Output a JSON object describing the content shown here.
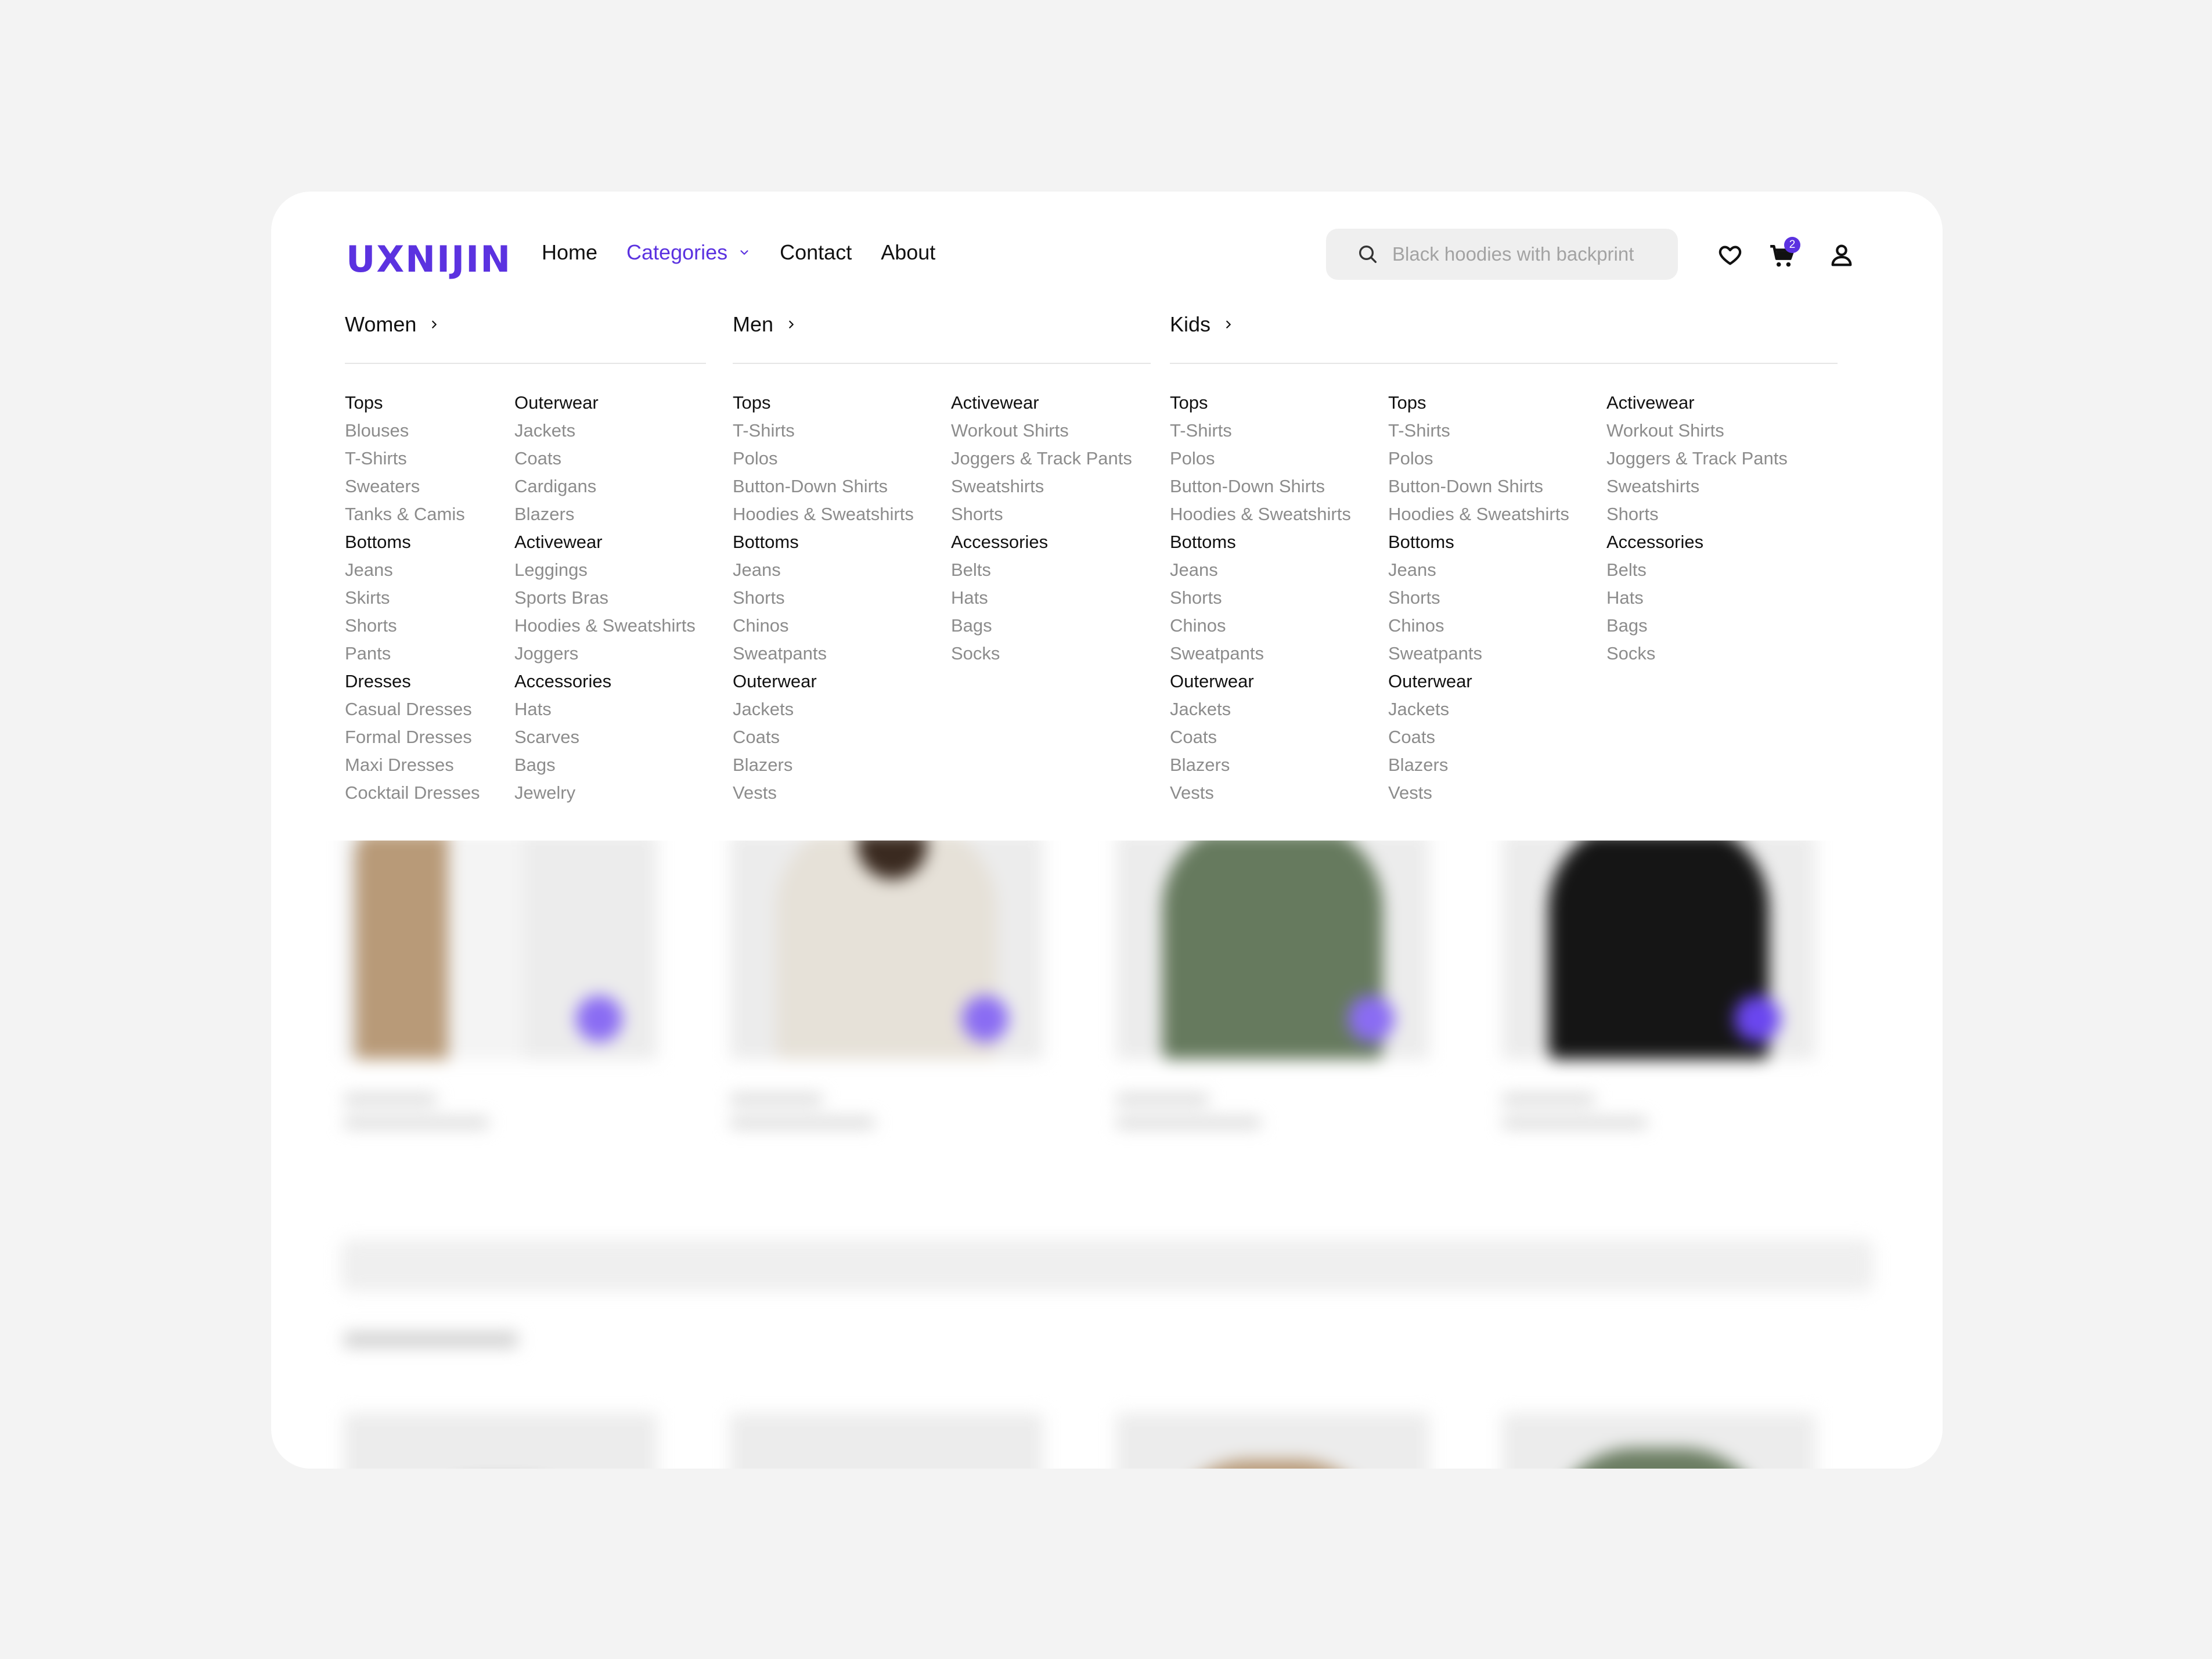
{
  "brand": {
    "logo": "UXNIJIN",
    "accent": "#5b32e0"
  },
  "nav": [
    {
      "label": "Home",
      "active": false
    },
    {
      "label": "Categories",
      "active": true
    },
    {
      "label": "Contact",
      "active": false
    },
    {
      "label": "About",
      "active": false
    }
  ],
  "search": {
    "placeholder": "Black hoodies with backprint"
  },
  "icons": {
    "wishlist": "heart-icon",
    "cart": "cart-icon",
    "account": "user-icon",
    "cart_count": "2"
  },
  "menu": {
    "women": {
      "title": "Women",
      "col1": [
        {
          "t": "Tops",
          "h": true
        },
        {
          "t": "Blouses"
        },
        {
          "t": "T-Shirts"
        },
        {
          "t": "Sweaters"
        },
        {
          "t": "Tanks & Camis"
        },
        {
          "t": "Bottoms",
          "h": true
        },
        {
          "t": "Jeans"
        },
        {
          "t": "Skirts"
        },
        {
          "t": "Shorts"
        },
        {
          "t": "Pants"
        },
        {
          "t": "Dresses",
          "h": true
        },
        {
          "t": "Casual Dresses"
        },
        {
          "t": "Formal Dresses"
        },
        {
          "t": "Maxi Dresses"
        },
        {
          "t": "Cocktail Dresses"
        }
      ],
      "col2": [
        {
          "t": "Outerwear",
          "h": true
        },
        {
          "t": "Jackets"
        },
        {
          "t": "Coats"
        },
        {
          "t": "Cardigans"
        },
        {
          "t": "Blazers"
        },
        {
          "t": "Activewear",
          "h": true
        },
        {
          "t": "Leggings"
        },
        {
          "t": "Sports Bras"
        },
        {
          "t": "Hoodies & Sweatshirts"
        },
        {
          "t": "Joggers"
        },
        {
          "t": "Accessories",
          "h": true
        },
        {
          "t": "Hats"
        },
        {
          "t": "Scarves"
        },
        {
          "t": "Bags"
        },
        {
          "t": "Jewelry"
        }
      ]
    },
    "men": {
      "title": "Men",
      "col1": [
        {
          "t": "Tops",
          "h": true
        },
        {
          "t": "T-Shirts"
        },
        {
          "t": "Polos"
        },
        {
          "t": "Button-Down Shirts"
        },
        {
          "t": "Hoodies & Sweatshirts"
        },
        {
          "t": "Bottoms",
          "h": true
        },
        {
          "t": "Jeans"
        },
        {
          "t": "Shorts"
        },
        {
          "t": "Chinos"
        },
        {
          "t": "Sweatpants"
        },
        {
          "t": "Outerwear",
          "h": true
        },
        {
          "t": "Jackets"
        },
        {
          "t": "Coats"
        },
        {
          "t": "Blazers"
        },
        {
          "t": "Vests"
        }
      ],
      "col2": [
        {
          "t": "Activewear",
          "h": true
        },
        {
          "t": "Workout Shirts"
        },
        {
          "t": "Joggers & Track Pants"
        },
        {
          "t": "Sweatshirts"
        },
        {
          "t": "Shorts"
        },
        {
          "t": "Accessories",
          "h": true
        },
        {
          "t": "Belts"
        },
        {
          "t": "Hats"
        },
        {
          "t": "Bags"
        },
        {
          "t": "Socks"
        }
      ]
    },
    "kids": {
      "title": "Kids",
      "col1": [
        {
          "t": "Tops",
          "h": true
        },
        {
          "t": "T-Shirts"
        },
        {
          "t": "Polos"
        },
        {
          "t": "Button-Down Shirts"
        },
        {
          "t": "Hoodies & Sweatshirts"
        },
        {
          "t": "Bottoms",
          "h": true
        },
        {
          "t": "Jeans"
        },
        {
          "t": "Shorts"
        },
        {
          "t": "Chinos"
        },
        {
          "t": "Sweatpants"
        },
        {
          "t": "Outerwear",
          "h": true
        },
        {
          "t": "Jackets"
        },
        {
          "t": "Coats"
        },
        {
          "t": "Blazers"
        },
        {
          "t": "Vests"
        }
      ],
      "col2": [
        {
          "t": "Tops",
          "h": true
        },
        {
          "t": "T-Shirts"
        },
        {
          "t": "Polos"
        },
        {
          "t": "Button-Down Shirts"
        },
        {
          "t": "Hoodies & Sweatshirts"
        },
        {
          "t": "Bottoms",
          "h": true
        },
        {
          "t": "Jeans"
        },
        {
          "t": "Shorts"
        },
        {
          "t": "Chinos"
        },
        {
          "t": "Sweatpants"
        },
        {
          "t": "Outerwear",
          "h": true
        },
        {
          "t": "Jackets"
        },
        {
          "t": "Coats"
        },
        {
          "t": "Blazers"
        },
        {
          "t": "Vests"
        }
      ],
      "col3": [
        {
          "t": "Activewear",
          "h": true
        },
        {
          "t": "Workout Shirts"
        },
        {
          "t": "Joggers & Track Pants"
        },
        {
          "t": "Sweatshirts"
        },
        {
          "t": "Shorts"
        },
        {
          "t": "Accessories",
          "h": true
        },
        {
          "t": "Belts"
        },
        {
          "t": "Hats"
        },
        {
          "t": "Bags"
        },
        {
          "t": "Socks"
        }
      ]
    }
  },
  "products_blurred": {
    "row1_colors": [
      "#b89a78",
      "#e6e1d8",
      "#667a5e",
      "#151515"
    ],
    "row2_colors": [
      "#1d1d1d",
      "#ece9e2",
      "#b89a78",
      "#6b7d62"
    ],
    "fab_color": "#8a6cf3"
  }
}
